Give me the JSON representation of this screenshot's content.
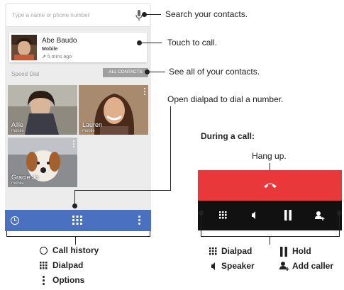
{
  "phone": {
    "search_placeholder": "Type a name or phone number",
    "recent": {
      "name": "Abe Baudo",
      "type": "Mobile",
      "time": "5 mins ago"
    },
    "speed_dial_label": "Speed Dial",
    "all_contacts_button": "ALL CONTACTS",
    "tiles": [
      {
        "name": "Allie",
        "sub": "mobile"
      },
      {
        "name": "Lauren",
        "sub": "mobile"
      },
      {
        "name": "Gracie Jo",
        "sub": "mobile"
      }
    ]
  },
  "callouts": {
    "search": "Search your contacts.",
    "touch": "Touch to call.",
    "see_all": "See all of your contacts.",
    "open_dialpad": "Open dialpad to dial a number."
  },
  "call": {
    "title": "During a call:",
    "hang_up": "Hang up."
  },
  "legend": {
    "call_history": "Call history",
    "dialpad": "Dialpad",
    "options": "Options",
    "dialpad_call": "Dialpad",
    "speaker": "Speaker",
    "hold": "Hold",
    "add_caller": "Add caller"
  },
  "colors": {
    "bottom_bar": "#4a70c0",
    "hangup_red": "#e8383a",
    "call_bar_black": "#111111"
  },
  "icons": [
    "mic-icon",
    "call-history-icon",
    "dialpad-icon",
    "options-icon",
    "hangup-icon",
    "speaker-icon",
    "hold-icon",
    "add-caller-icon"
  ]
}
